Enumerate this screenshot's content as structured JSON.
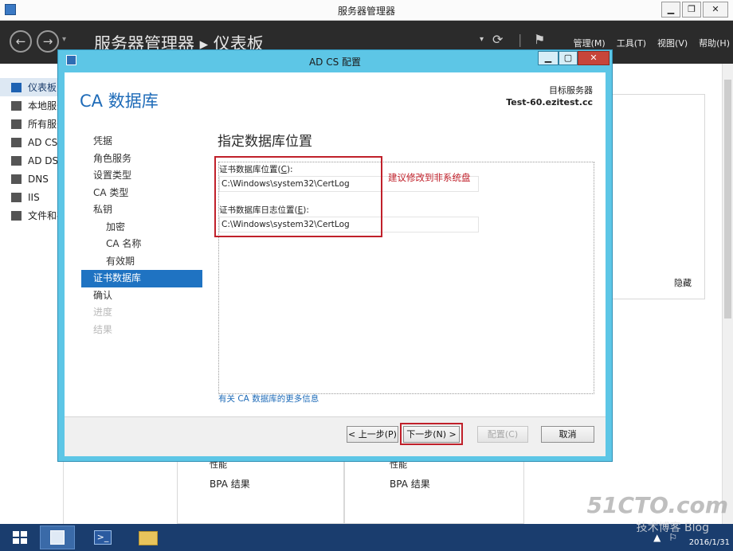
{
  "server_manager": {
    "window_title": "服务器管理器",
    "breadcrumb": "服务器管理器 ▸ 仪表板",
    "menus": [
      "管理(M)",
      "工具(T)",
      "视图(V)",
      "帮助(H)"
    ],
    "sidebar": [
      {
        "label": "仪表板",
        "icon": "dashboard-icon"
      },
      {
        "label": "本地服务器",
        "icon": "server-icon"
      },
      {
        "label": "所有服务器",
        "icon": "servers-icon"
      },
      {
        "label": "AD CS",
        "icon": "adcs-icon"
      },
      {
        "label": "AD DS",
        "icon": "adds-icon"
      },
      {
        "label": "DNS",
        "icon": "dns-icon"
      },
      {
        "label": "IIS",
        "icon": "iis-icon"
      },
      {
        "label": "文件和存储服务",
        "icon": "file-storage-icon"
      }
    ],
    "hide_label": "隐藏",
    "tiles": [
      {
        "perf_label": "性能",
        "bpa_label": "BPA 结果"
      },
      {
        "perf_label": "性能",
        "bpa_label": "BPA 结果"
      }
    ]
  },
  "dialog": {
    "title": "AD CS 配置",
    "caption": "CA 数据库",
    "target_label": "目标服务器",
    "target_server": "Test-60.ezitest.cc",
    "nav": [
      {
        "label": "凭据",
        "state": "normal",
        "level": 0
      },
      {
        "label": "角色服务",
        "state": "normal",
        "level": 0
      },
      {
        "label": "设置类型",
        "state": "normal",
        "level": 0
      },
      {
        "label": "CA 类型",
        "state": "normal",
        "level": 0
      },
      {
        "label": "私钥",
        "state": "normal",
        "level": 0
      },
      {
        "label": "加密",
        "state": "normal",
        "level": 1
      },
      {
        "label": "CA 名称",
        "state": "normal",
        "level": 1
      },
      {
        "label": "有效期",
        "state": "normal",
        "level": 1
      },
      {
        "label": "证书数据库",
        "state": "active",
        "level": 0
      },
      {
        "label": "确认",
        "state": "normal",
        "level": 0
      },
      {
        "label": "进度",
        "state": "disabled",
        "level": 0
      },
      {
        "label": "结果",
        "state": "disabled",
        "level": 0
      }
    ],
    "section_title": "指定数据库位置",
    "db_location_label": "证书数据库位置(",
    "db_location_key": "C",
    "db_location_label_end": "):",
    "db_location_value": "C:\\Windows\\system32\\CertLog",
    "db_log_label": "证书数据库日志位置(",
    "db_log_key": "E",
    "db_log_label_end": "):",
    "db_log_value": "C:\\Windows\\system32\\CertLog",
    "annotation": "建议修改到非系统盘",
    "more_info_link": "有关 CA 数据库的更多信息",
    "buttons": {
      "back": "< 上一步(P)",
      "next": "下一步(N) >",
      "configure": "配置(C)",
      "cancel": "取消"
    }
  },
  "taskbar": {
    "clock_date": "2016/1/31"
  },
  "watermark": {
    "main": "51CTO.com",
    "sub": "技术博客 Blog"
  },
  "colors": {
    "dialog_frame": "#5dc6e6",
    "accent_blue": "#1e6bb8",
    "active_nav": "#1f73c2",
    "annotation_red": "#c0202a",
    "taskbar": "#1a3d6e"
  }
}
